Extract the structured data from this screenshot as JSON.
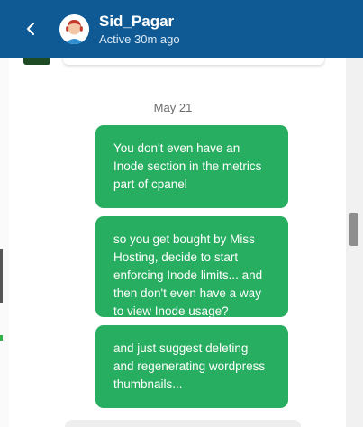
{
  "header": {
    "contact_name": "Sid_Pagar",
    "status": "Active 30m ago"
  },
  "conversation": {
    "date_separator": "May 21",
    "messages": [
      {
        "text": "You don't even have an Inode section in the metrics part of cpanel"
      },
      {
        "text": "so you get bought by Miss Hosting, decide to start enforcing Inode limits... and then don't even have a way to view Inode usage?"
      },
      {
        "text": "and just suggest deleting and regenerating wordpress thumbnails..."
      }
    ]
  },
  "colors": {
    "header_bg": "#0f5a94",
    "bubble_bg": "#27ae60"
  },
  "icons": {
    "back": "chevron-left-icon"
  }
}
